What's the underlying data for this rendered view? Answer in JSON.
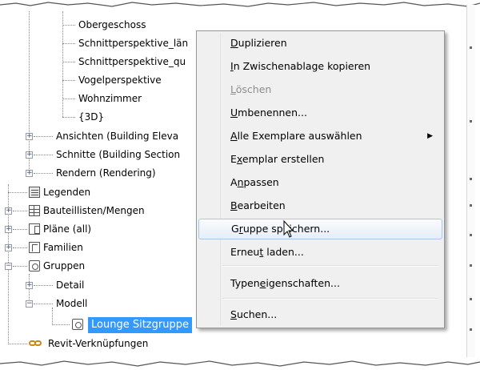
{
  "tree": {
    "items": [
      {
        "label": "Obergeschoss"
      },
      {
        "label": "Schnittperspektive_län"
      },
      {
        "label": "Schnittperspektive_qu"
      },
      {
        "label": "Vogelperspektive"
      },
      {
        "label": "Wohnzimmer"
      },
      {
        "label": "{3D}"
      },
      {
        "label": "Ansichten (Building Eleva"
      },
      {
        "label": "Schnitte (Building Section"
      },
      {
        "label": "Rendern (Rendering)"
      },
      {
        "label": "Legenden"
      },
      {
        "label": "Bauteillisten/Mengen"
      },
      {
        "label": "Pläne (all)"
      },
      {
        "label": "Familien"
      },
      {
        "label": "Gruppen"
      },
      {
        "label": "Detail"
      },
      {
        "label": "Modell"
      },
      {
        "label": "Lounge Sitzgruppe"
      },
      {
        "label": "Revit-Verknüpfungen"
      }
    ]
  },
  "context_menu": {
    "items": [
      {
        "pre": "",
        "key": "D",
        "post": "uplizieren",
        "state": "normal"
      },
      {
        "pre": "",
        "key": "I",
        "post": "n Zwischenablage kopieren",
        "state": "normal"
      },
      {
        "pre": "",
        "key": "L",
        "post": "öschen",
        "state": "disabled"
      },
      {
        "pre": "",
        "key": "U",
        "post": "mbenennen...",
        "state": "normal"
      },
      {
        "pre": "",
        "key": "A",
        "post": "lle Exemplare auswählen",
        "state": "normal",
        "submenu": "▶"
      },
      {
        "pre": "E",
        "key": "x",
        "post": "emplar erstellen",
        "state": "normal"
      },
      {
        "pre": "A",
        "key": "n",
        "post": "passen",
        "state": "normal"
      },
      {
        "pre": "",
        "key": "B",
        "post": "earbeiten",
        "state": "normal"
      },
      {
        "pre": "G",
        "key": "r",
        "post": "uppe speichern...",
        "state": "hover"
      },
      {
        "pre": "Erneu",
        "key": "t",
        "post": " laden...",
        "state": "normal"
      },
      {
        "pre": "Typen",
        "key": "e",
        "post": "igenschaften...",
        "state": "normal"
      },
      {
        "pre": "",
        "key": "S",
        "post": "uchen...",
        "state": "normal"
      }
    ]
  },
  "colors": {
    "selection": "#3399ff",
    "menu_background": "#f0f0f0",
    "menu_hover_border": "#a8c7ee",
    "link_icon": "#c88a16"
  }
}
